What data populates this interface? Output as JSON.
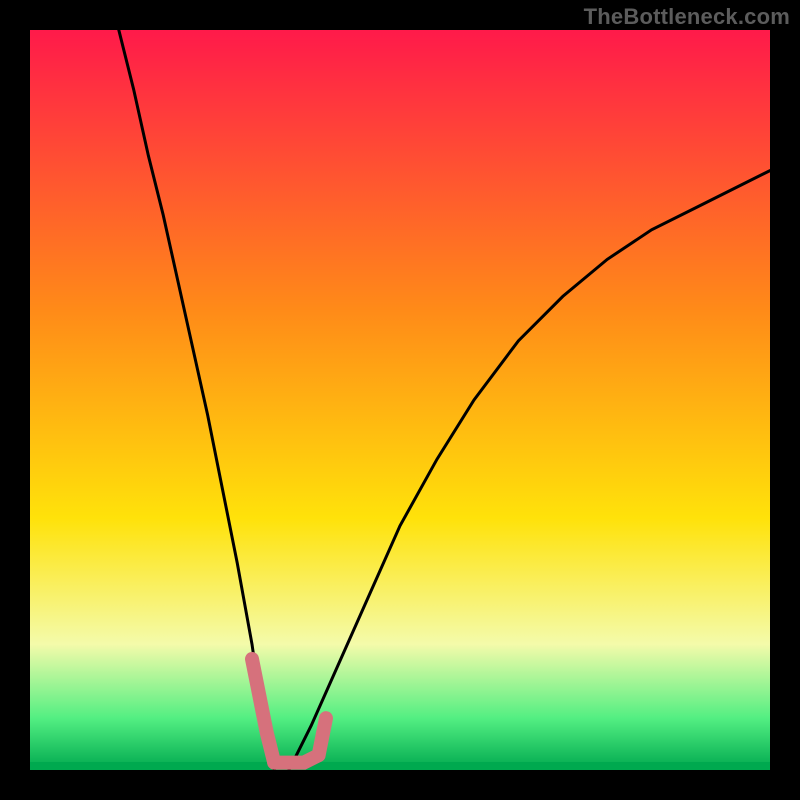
{
  "watermark": "TheBottleneck.com",
  "colors": {
    "black": "#000000",
    "curve": "#000000",
    "pink_stroke": "#d6717c",
    "grad_top": "#ff1a4a",
    "grad_mid_orange": "#ff8b18",
    "grad_yellow": "#ffe20a",
    "grad_pale": "#f4fbaa",
    "grad_green_light": "#53ef82",
    "grad_green_dark": "#00a94f"
  },
  "chart_data": {
    "type": "line",
    "title": "",
    "xlabel": "",
    "ylabel": "",
    "xlim": [
      0,
      100
    ],
    "ylim": [
      0,
      100
    ],
    "notes": "Decorative bottleneck-style chart. Two curves plotted over a vertical red→green gradient. Left curve descends steeply from top-left to a minimum near x≈33 (y≈0) then rises slightly. Right curve rises from the same minimum region toward upper right, concave down. Pink highlight segments mark the V-shaped region near the minimum. Values estimated from pixels; no numeric axes are shown.",
    "series": [
      {
        "name": "left_curve",
        "x": [
          12,
          14,
          16,
          18,
          20,
          22,
          24,
          26,
          28,
          30,
          31,
          32,
          33
        ],
        "y": [
          100,
          92,
          83,
          75,
          66,
          57,
          48,
          38,
          28,
          17,
          10,
          4,
          0
        ]
      },
      {
        "name": "right_curve",
        "x": [
          35,
          38,
          42,
          46,
          50,
          55,
          60,
          66,
          72,
          78,
          84,
          90,
          96,
          100
        ],
        "y": [
          0,
          6,
          15,
          24,
          33,
          42,
          50,
          58,
          64,
          69,
          73,
          76,
          79,
          81
        ]
      },
      {
        "name": "pink_left_segment",
        "x": [
          30,
          31,
          32,
          33
        ],
        "y": [
          15,
          10,
          5,
          1
        ]
      },
      {
        "name": "pink_bottom_segment",
        "x": [
          33,
          35,
          37,
          39
        ],
        "y": [
          1,
          1,
          1,
          2
        ]
      },
      {
        "name": "pink_right_stub",
        "x": [
          39,
          40
        ],
        "y": [
          2,
          7
        ]
      }
    ]
  }
}
